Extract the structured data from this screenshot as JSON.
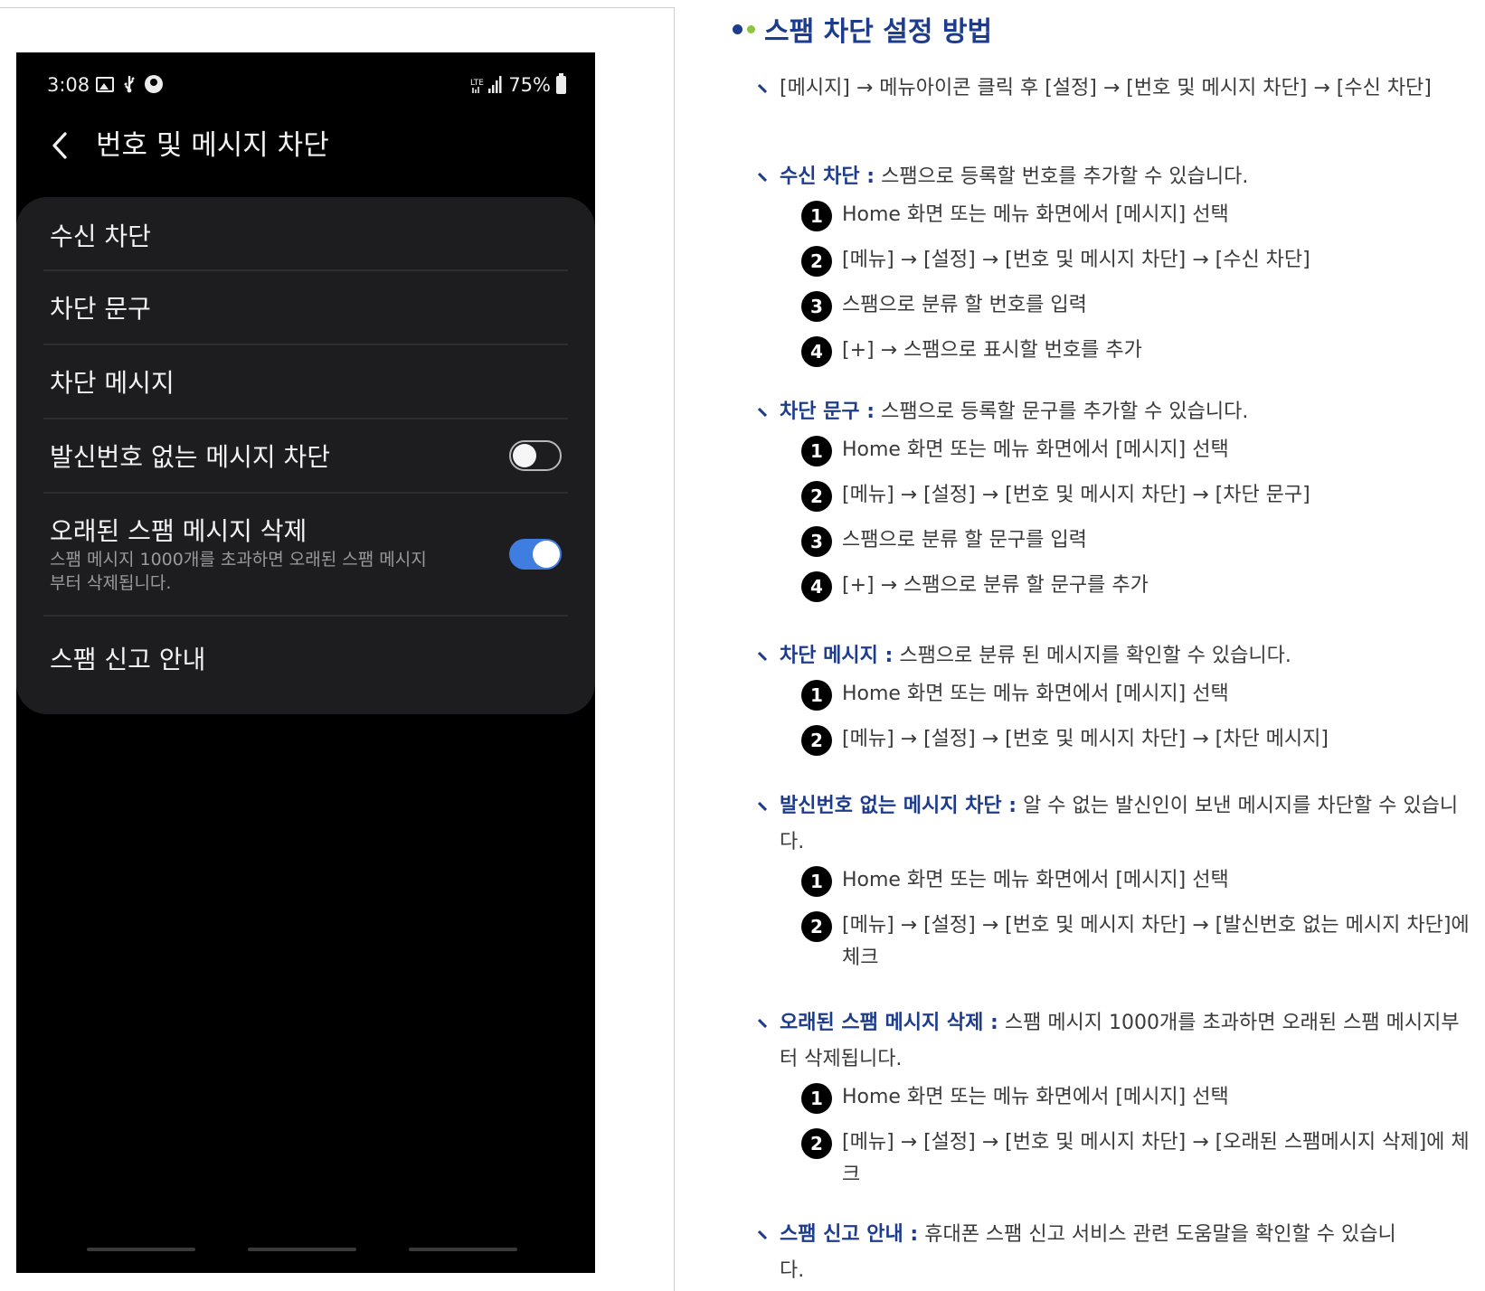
{
  "phone": {
    "status_bar": {
      "time": "3:08",
      "battery": "75%",
      "icons": [
        "image-icon",
        "usb-icon",
        "info-icon",
        "volte-signal-icon",
        "battery-icon"
      ]
    },
    "app_bar": {
      "title": "번호 및 메시지 차단",
      "back_icon": "chevron-left-icon"
    },
    "settings": [
      {
        "label": "수신 차단"
      },
      {
        "label": "차단 문구"
      },
      {
        "label": "차단 메시지"
      },
      {
        "label": "발신번호 없는 메시지 차단",
        "toggle": false
      },
      {
        "label": "오래된 스팸 메시지 삭제",
        "sub": "스팸 메시지 1000개를 초과하면 오래된 스팸 메시지부터 삭제됩니다.",
        "toggle": true
      },
      {
        "label": "스팸 신고 안내"
      }
    ],
    "colors": {
      "toggle_on": "#3f7de0",
      "card_bg": "#1d1d1f"
    }
  },
  "doc": {
    "title": "스팸 차단 설정 방법",
    "title_color": "#1e3c8c",
    "dot_colors": [
      "#1e3c8c",
      "#8cc63f"
    ],
    "path_line": "[메시지] → 메뉴아이콘 클릭 후 [설정] → [번호 및 메시지 차단] → [수신 차단]",
    "sections": [
      {
        "key": "수신 차단 :",
        "desc": "스팸으로 등록할 번호를 추가할 수 있습니다.",
        "steps": [
          {
            "num": "1",
            "text": "Home 화면 또는 메뉴 화면에서 [메시지] 선택"
          },
          {
            "num": "2",
            "text": "[메뉴] → [설정] → [번호 및 메시지 차단] → [수신 차단]"
          },
          {
            "num": "3",
            "text": "스팸으로 분류 할 번호를 입력"
          },
          {
            "num": "4",
            "text": "[+] → 스팸으로 표시할 번호를 추가"
          }
        ]
      },
      {
        "key": "차단 문구 :",
        "desc": "스팸으로 등록할 문구를 추가할 수 있습니다.",
        "steps": [
          {
            "num": "1",
            "text": "Home 화면 또는 메뉴 화면에서 [메시지] 선택"
          },
          {
            "num": "2",
            "text": "[메뉴] → [설정] → [번호 및 메시지 차단] → [차단 문구]"
          },
          {
            "num": "3",
            "text": "스팸으로 분류 할 문구를 입력"
          },
          {
            "num": "4",
            "text": "[+] → 스팸으로 분류 할 문구를 추가"
          }
        ]
      },
      {
        "key": "차단 메시지 :",
        "desc": "스팸으로 분류 된 메시지를 확인할 수 있습니다.",
        "steps": [
          {
            "num": "1",
            "text": "Home 화면 또는 메뉴 화면에서 [메시지] 선택"
          },
          {
            "num": "2",
            "text": "[메뉴] → [설정] → [번호 및 메시지 차단] → [차단 메시지]"
          }
        ]
      },
      {
        "key": "발신번호 없는 메시지 차단 :",
        "desc": "알 수 없는 발신인이 보낸 메시지를 차단할 수 있습니다.",
        "steps": [
          {
            "num": "1",
            "text": "Home 화면 또는 메뉴 화면에서 [메시지] 선택"
          },
          {
            "num": "2",
            "text": "[메뉴] → [설정] → [번호 및 메시지 차단] → [발신번호 없는 메시지 차단]에 체크"
          }
        ]
      },
      {
        "key": "오래된 스팸 메시지 삭제 :",
        "desc": "스팸 메시지 1000개를 초과하면 오래된 스팸 메시지부터 삭제됩니다.",
        "steps": [
          {
            "num": "1",
            "text": "Home 화면 또는 메뉴 화면에서 [메시지] 선택"
          },
          {
            "num": "2",
            "text": "[메뉴] → [설정] → [번호 및 메시지 차단] → [오래된 스팸메시지 삭제]에 체크"
          }
        ]
      },
      {
        "key": "스팸 신고 안내 :",
        "desc": "휴대폰 스팸 신고 서비스 관련 도움말을 확인할 수 있습니다.",
        "steps": []
      }
    ]
  }
}
